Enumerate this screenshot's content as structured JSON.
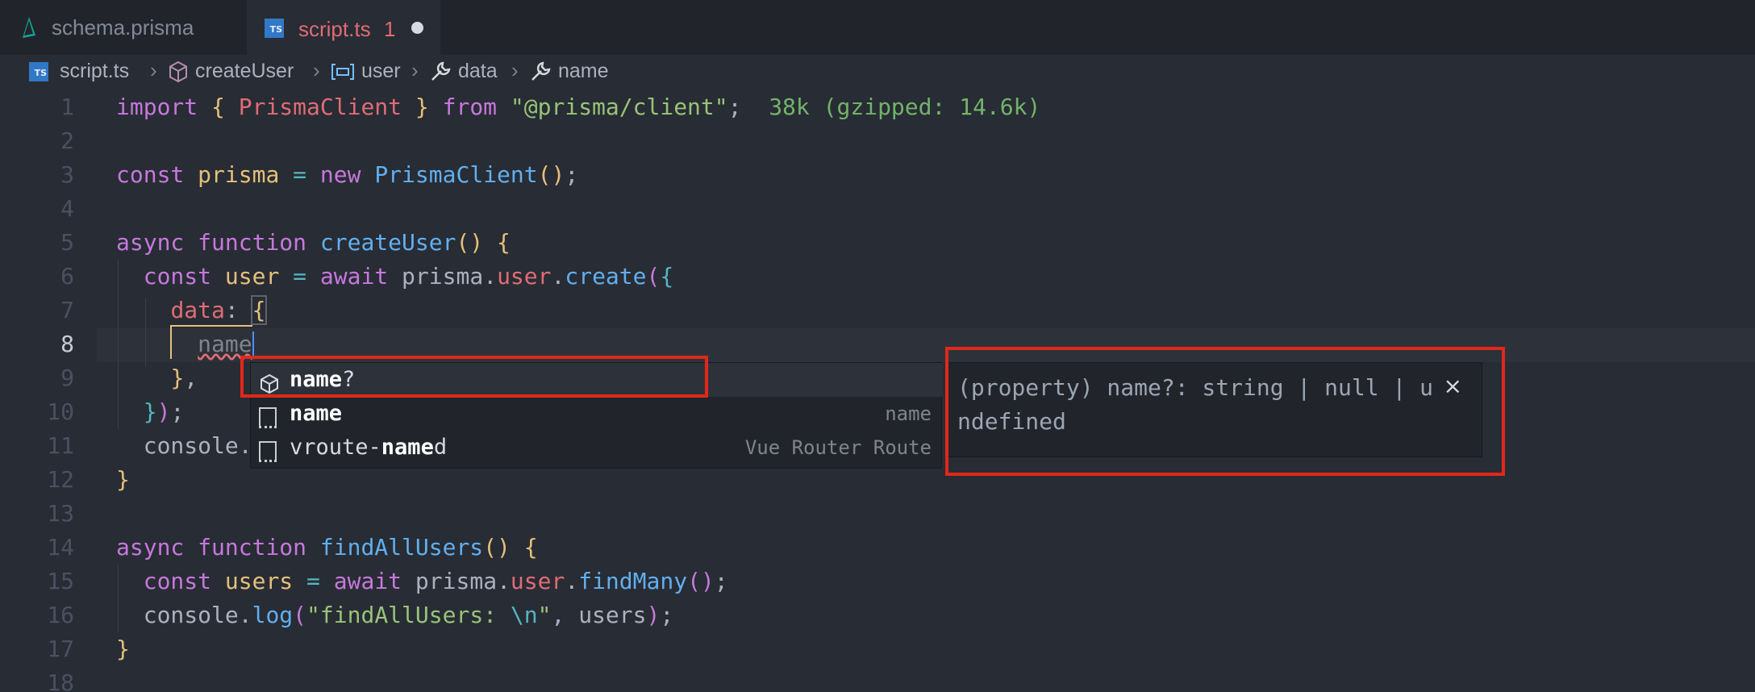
{
  "tabs": [
    {
      "label": "schema.prisma"
    },
    {
      "label": "script.ts",
      "problems": "1"
    }
  ],
  "breadcrumb": {
    "file": "script.ts",
    "items": [
      "createUser",
      "user",
      "data",
      "name"
    ]
  },
  "editor": {
    "line_numbers": [
      "1",
      "2",
      "3",
      "4",
      "5",
      "6",
      "7",
      "8",
      "9",
      "10",
      "11",
      "12",
      "13",
      "14",
      "15",
      "16",
      "17",
      "18"
    ],
    "import_kw": "import",
    "import_name": "PrismaClient",
    "from_kw": "from",
    "import_src": "\"@prisma/client\"",
    "import_size": "38k (gzipped: 14.6k)",
    "l3_const": "const",
    "l3_var": "prisma",
    "l3_new": "new",
    "l3_class": "PrismaClient",
    "l5_async": "async",
    "l5_function": "function",
    "l5_name": "createUser",
    "l6_const": "const",
    "l6_var": "user",
    "l6_await": "await",
    "l6_obj": "prisma",
    "l6_prop": "user",
    "l6_method": "create",
    "l7_key": "data",
    "l8_typed": "name",
    "l11_text": "console.",
    "l14_async": "async",
    "l14_function": "function",
    "l14_name": "findAllUsers",
    "l15_const": "const",
    "l15_var": "users",
    "l15_await": "await",
    "l15_obj": "prisma",
    "l15_prop": "user",
    "l15_method": "findMany",
    "l16_obj": "console",
    "l16_method": "log",
    "l16_str_a": "\"findAllUsers: ",
    "l16_esc": "\\n",
    "l16_str_b": "\"",
    "l16_arg": "users"
  },
  "suggest": {
    "items": [
      {
        "bold": "name",
        "rest": "?",
        "detail": "",
        "icon": "property-icon"
      },
      {
        "bold": "name",
        "rest": "",
        "detail": "name",
        "icon": "word-icon"
      },
      {
        "pre": "vroute-",
        "bold": "name",
        "rest": "d",
        "detail": "Vue Router Route",
        "icon": "word-icon"
      }
    ]
  },
  "details": {
    "line1": "(property) name?: string | null | u",
    "line2": "ndefined",
    "close": "×"
  },
  "colors": {
    "editor_bg": "#282c34",
    "highlight_box": "#e0281a",
    "keyword": "#c678dd",
    "function": "#61afef",
    "string": "#98c379"
  }
}
